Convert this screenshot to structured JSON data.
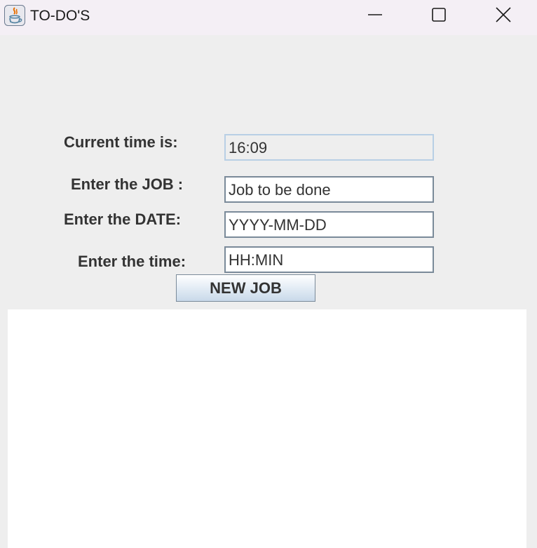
{
  "window": {
    "title": "TO-DO'S",
    "app_icon": "java-icon"
  },
  "title_controls": {
    "minimize_icon": "minimize-icon",
    "maximize_icon": "maximize-icon",
    "close_icon": "close-icon"
  },
  "form": {
    "current_time_label": "Current time is:",
    "current_time_value": "16:09",
    "job_label": "Enter the JOB :",
    "job_value": "Job to be done",
    "date_label": "Enter the DATE:",
    "date_value": "YYYY-MM-DD",
    "time_label": "Enter the time:",
    "time_value": "HH:MIN",
    "new_job_button": "NEW JOB"
  },
  "job_list": {
    "items": []
  },
  "colors": {
    "titlebar_bg": "#f4eff5",
    "panel_bg": "#eeeeee",
    "text": "#333333",
    "readonly_border": "#b8cfe5"
  }
}
